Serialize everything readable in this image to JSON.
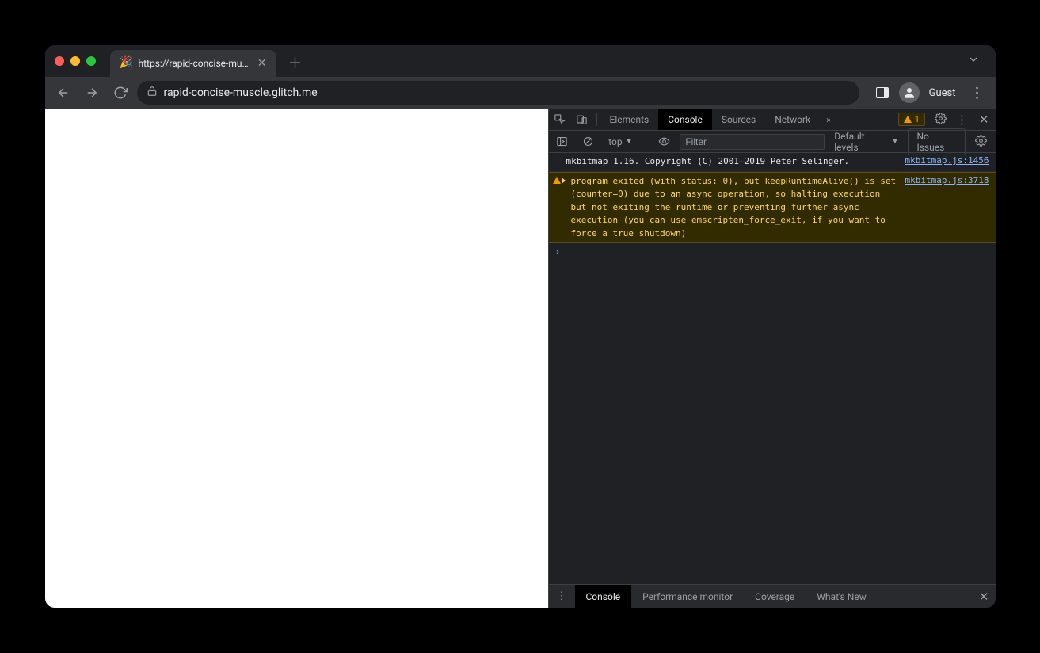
{
  "titlebar": {
    "tab_title": "https://rapid-concise-muscle.g",
    "favicon": "🎉"
  },
  "toolbar": {
    "url_display": "rapid-concise-muscle.glitch.me",
    "guest_label": "Guest"
  },
  "devtools": {
    "tabs": {
      "elements": "Elements",
      "console": "Console",
      "sources": "Sources",
      "network": "Network"
    },
    "warn_count": "1"
  },
  "console_toolbar": {
    "context_label": "top",
    "filter_placeholder": "Filter",
    "levels_label": "Default levels",
    "no_issues_label": "No Issues"
  },
  "messages": {
    "info": {
      "text": "mkbitmap 1.16. Copyright (C) 2001–2019 Peter Selinger.",
      "source": "mkbitmap.js:1456"
    },
    "warn": {
      "text": "program exited (with status: 0), but keepRuntimeAlive() is set (counter=0) due to an async operation, so halting execution but not exiting the runtime or preventing further async execution (you can use emscripten_force_exit, if you want to force a true shutdown)",
      "source": "mkbitmap.js:3718"
    }
  },
  "drawer": {
    "console": "Console",
    "perf": "Performance monitor",
    "coverage": "Coverage",
    "whatsnew": "What's New"
  }
}
